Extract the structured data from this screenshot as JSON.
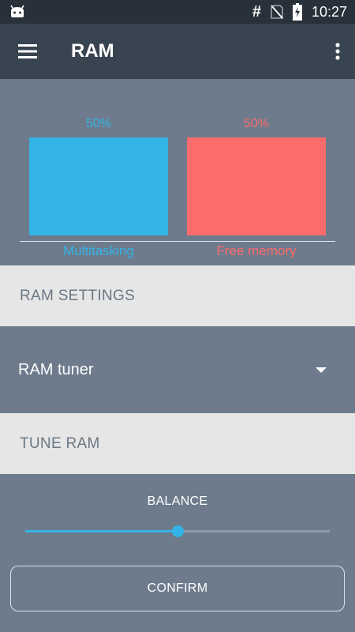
{
  "status_bar": {
    "hash_symbol": "#",
    "time": "10:27",
    "icons": [
      "android-robot-icon",
      "no-sim-icon",
      "battery-charging-icon"
    ]
  },
  "app_bar": {
    "title": "RAM",
    "menu_icon": "hamburger-menu-icon",
    "overflow_icon": "more-vert-icon"
  },
  "chart_data": {
    "type": "bar",
    "categories": [
      "Multitasking",
      "Free memory"
    ],
    "values": [
      50,
      50
    ],
    "value_labels": [
      "50%",
      "50%"
    ],
    "colors": [
      "#33b4e6",
      "#fe6b6b"
    ],
    "ylim": [
      0,
      50
    ],
    "grid": false
  },
  "sections": {
    "ram_settings": "RAM SETTINGS",
    "tune_ram": "TUNE RAM"
  },
  "dropdown": {
    "selected": "RAM tuner"
  },
  "balance": {
    "label": "BALANCE",
    "value_fraction": 0.5
  },
  "confirm": {
    "label": "CONFIRM"
  },
  "colors": {
    "status_bar": "#28313a",
    "app_bar": "#38444f",
    "background": "#6d7b8c",
    "section_header_bg": "#e6e6e6",
    "accent": "#33b4e6",
    "free_memory": "#fe6b6b"
  }
}
